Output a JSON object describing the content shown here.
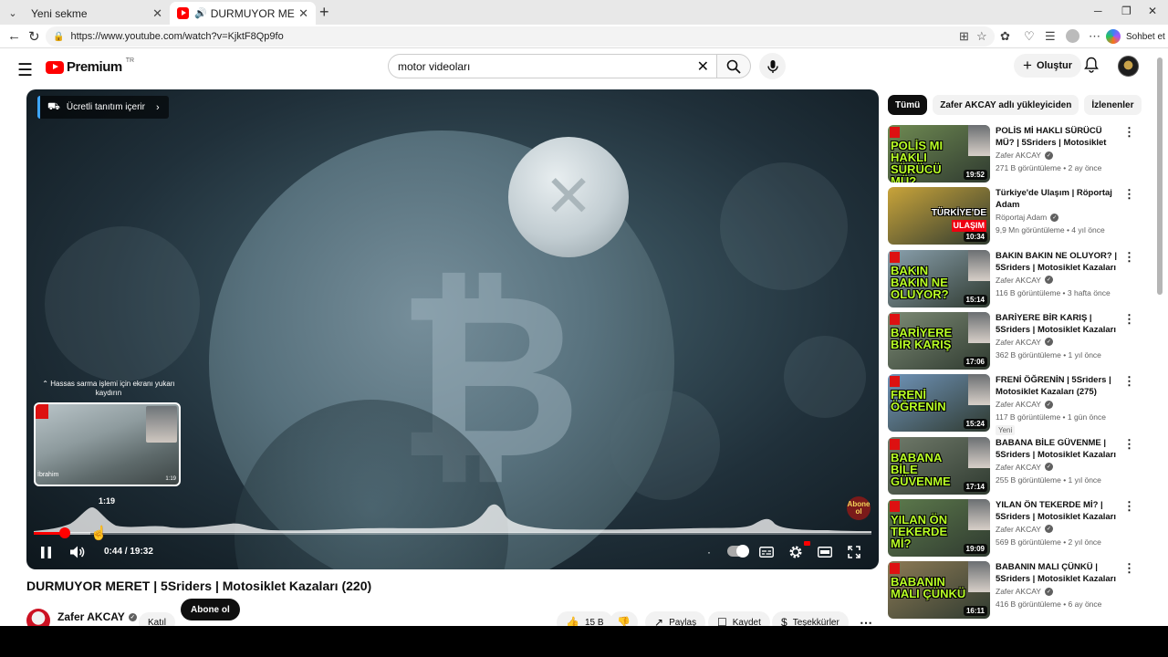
{
  "browser": {
    "tabs": [
      {
        "title": "Yeni sekme",
        "active": false
      },
      {
        "title": "DURMUYOR MERET | 5Sriders | Motosiklet Kazaları (220)",
        "active": true
      }
    ],
    "url": "https://www.youtube.com/watch?v=KjktF8Qp9fo",
    "copilot_label": "Sohbet et"
  },
  "masthead": {
    "logo_text": "Premium",
    "region": "TR",
    "search_value": "motor videoları",
    "create_label": "Oluştur"
  },
  "player": {
    "promo_label": "Ücretli tanıtım içerir",
    "seek_hint": "Hassas sarma işlemi için ekranı yukarı kaydırın",
    "hover_time": "1:19",
    "preview_name": "İbrahim",
    "preview_stamp": "1:19",
    "current_time": "0:44",
    "duration": "19:32",
    "timecode": "0:44 / 19:32",
    "progress_played": 0.0375,
    "progress_hover": 0.067,
    "watermark": "Abone ol"
  },
  "video": {
    "title": "DURMUYOR MERET | 5Sriders | Motosiklet Kazaları (220)",
    "channel": "Zafer AKCAY",
    "join_label": "Katıl",
    "subscribe_label": "Abone ol",
    "likes": "15 B",
    "share_label": "Paylaş",
    "save_label": "Kaydet",
    "thanks_label": "Teşekkürler"
  },
  "sidebar": {
    "chips": [
      "Tümü",
      "Zafer AKCAY adlı yükleyiciden",
      "İzlenenler"
    ],
    "items": [
      {
        "title": "POLİS Mİ HAKLI SÜRÜCÜ MÜ? | 5Sriders | Motosiklet Kazaları ...",
        "channel": "Zafer AKCAY",
        "meta": "271 B görüntüleme • 2 ay önce",
        "duration": "19:52",
        "thumb_text": "POLİS MI HAKLI SÜRÜCÜ MÜ?",
        "thumb_bg": "#6f8a52"
      },
      {
        "title": "Türkiye'de Ulaşım | Röportaj Adam",
        "channel": "Röportaj Adam",
        "meta": "9,9 Mn görüntüleme • 4 yıl önce",
        "duration": "10:34",
        "thumb_text": "TÜRKİYE'DE",
        "thumb_text2": "ULAŞIM",
        "thumb_bg": "#c9a43a"
      },
      {
        "title": "BAKIN BAKIN NE OLUYOR? | 5Sriders | Motosiklet Kazaları ...",
        "channel": "Zafer AKCAY",
        "meta": "116 B görüntüleme • 3 hafta önce",
        "duration": "15:14",
        "thumb_text": "BAKIN BAKIN NE OLUYOR?",
        "thumb_bg": "#8aa0ad"
      },
      {
        "title": "BARİYERE BİR KARIŞ | 5Sriders | Motosiklet Kazaları (188)",
        "channel": "Zafer AKCAY",
        "meta": "362 B görüntüleme • 1 yıl önce",
        "duration": "17:06",
        "thumb_text": "BARİYERE BİR KARIŞ",
        "thumb_bg": "#7c8a74"
      },
      {
        "title": "FRENİ ÖĞRENİN | 5Sriders | Motosiklet Kazaları (275)",
        "channel": "Zafer AKCAY",
        "meta": "117 B görüntüleme • 1 gün önce",
        "badge": "Yeni",
        "duration": "15:24",
        "thumb_text": "FRENİ ÖĞRENİN",
        "thumb_bg": "#6f93b8"
      },
      {
        "title": "BABANA BİLE GÜVENME | 5Sriders | Motosiklet Kazaları ...",
        "channel": "Zafer AKCAY",
        "meta": "255 B görüntüleme • 1 yıl önce",
        "duration": "17:14",
        "thumb_text": "BABANA BİLE GÜVENME",
        "thumb_bg": "#707a6a"
      },
      {
        "title": "YILAN ÖN TEKERDE Mİ? | 5Sriders | Motosiklet Kazaları ...",
        "channel": "Zafer AKCAY",
        "meta": "569 B görüntüleme • 2 yıl önce",
        "duration": "19:09",
        "thumb_text": "YILAN ÖN TEKERDE Mİ?",
        "thumb_bg": "#5d7a4c"
      },
      {
        "title": "BABANIN MALI ÇÜNKÜ | 5Sriders | Motosiklet Kazaları ...",
        "channel": "Zafer AKCAY",
        "meta": "416 B görüntüleme • 6 ay önce",
        "duration": "16:11",
        "thumb_text": "BABANIN MALI ÇÜNKÜ",
        "thumb_bg": "#8c7a55"
      }
    ]
  }
}
